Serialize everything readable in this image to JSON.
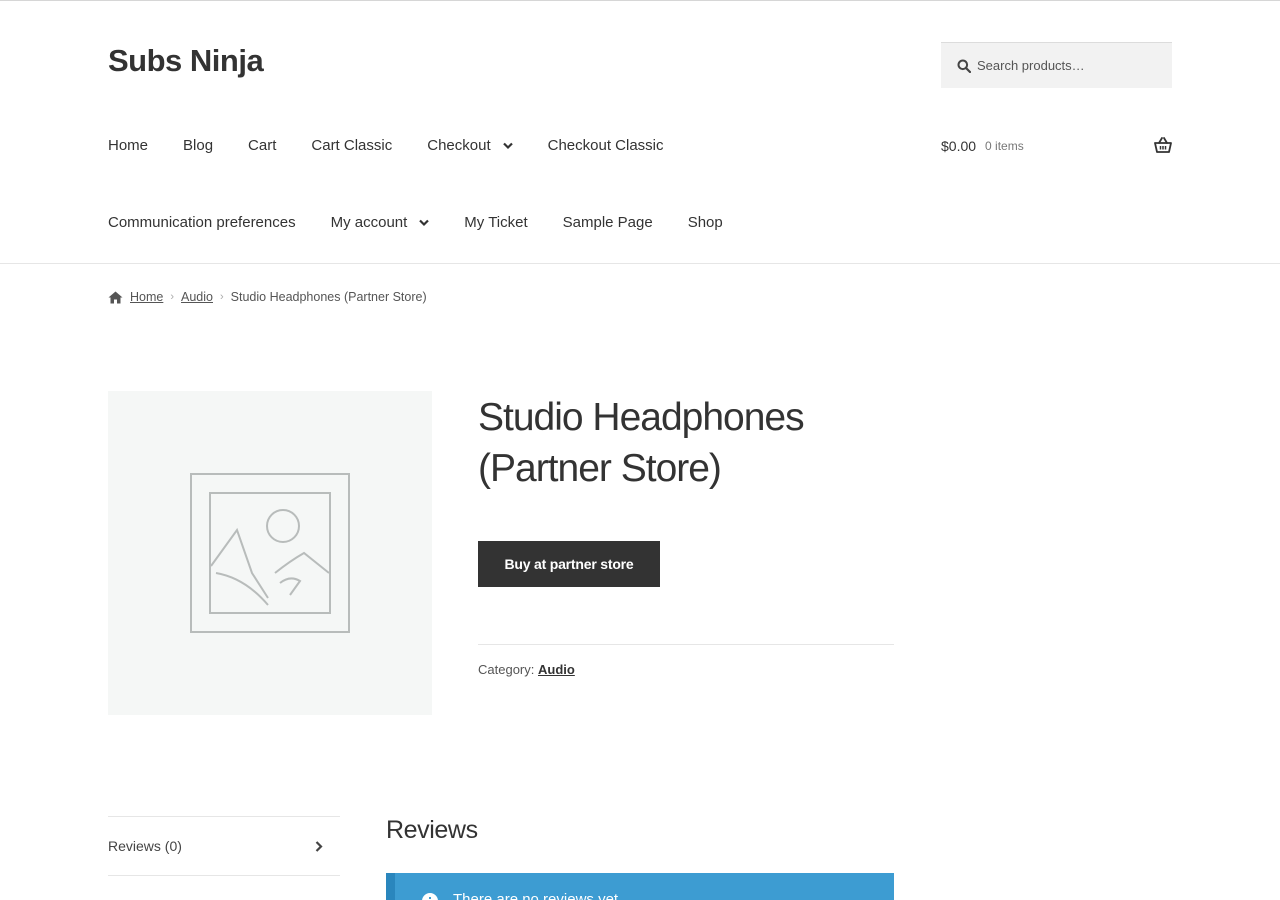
{
  "site": {
    "title": "Subs Ninja"
  },
  "search": {
    "placeholder": "Search products…"
  },
  "nav": {
    "row1": [
      {
        "label": "Home"
      },
      {
        "label": "Blog"
      },
      {
        "label": "Cart"
      },
      {
        "label": "Cart Classic"
      },
      {
        "label": "Checkout",
        "has_submenu": true
      },
      {
        "label": "Checkout Classic"
      }
    ],
    "row2": [
      {
        "label": "Communication preferences"
      },
      {
        "label": "My account",
        "has_submenu": true
      },
      {
        "label": "My Ticket"
      },
      {
        "label": "Sample Page"
      },
      {
        "label": "Shop"
      }
    ]
  },
  "cart": {
    "total": "$0.00",
    "count": "0 items",
    "icon": "basket-icon"
  },
  "breadcrumb": {
    "home": "Home",
    "category": "Audio",
    "current": "Studio Headphones (Partner Store)"
  },
  "product": {
    "title": "Studio Headphones (Partner Store)",
    "button_label": "Buy at partner store",
    "category_label": "Category:",
    "category": "Audio"
  },
  "tabs": {
    "reviews": "Reviews (0)"
  },
  "reviews": {
    "heading": "Reviews",
    "notice": "There are no reviews yet."
  },
  "colors": {
    "button_bg": "#333333",
    "notice_bg": "#3d9cd2",
    "notice_border": "#2a86bd",
    "image_bg": "#f5f7f6"
  }
}
